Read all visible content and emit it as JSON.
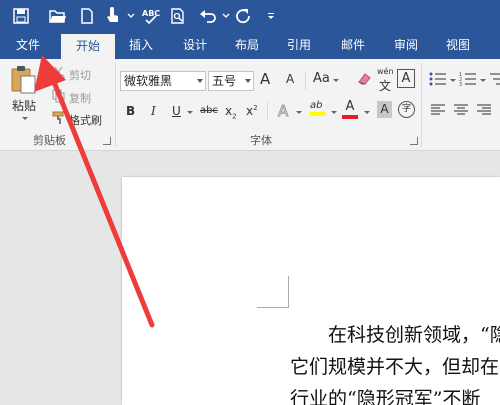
{
  "qat": {
    "icons": [
      "save-icon",
      "open-folder-icon",
      "new-document-icon",
      "touch-mode-icon",
      "spelling-check-icon",
      "print-preview-icon",
      "undo-icon",
      "redo-icon",
      "customize-toolbar-icon"
    ]
  },
  "tabs": [
    {
      "label": "文件",
      "active": false
    },
    {
      "label": "开始",
      "active": true
    },
    {
      "label": "插入",
      "active": false
    },
    {
      "label": "设计",
      "active": false
    },
    {
      "label": "布局",
      "active": false
    },
    {
      "label": "引用",
      "active": false
    },
    {
      "label": "邮件",
      "active": false
    },
    {
      "label": "审阅",
      "active": false
    },
    {
      "label": "视图",
      "active": false
    }
  ],
  "clipboard": {
    "paste_label": "粘贴",
    "cut_label": "剪切",
    "copy_label": "复制",
    "format_painter_label": "格式刷",
    "group_label": "剪贴板"
  },
  "font": {
    "font_name": "微软雅黑",
    "font_size": "五号",
    "grow_font": "A",
    "shrink_font": "A",
    "change_case": "Aa",
    "phonetic_top": "wén",
    "phonetic_bottom": "文",
    "char_border": "A",
    "bold": "B",
    "italic": "I",
    "underline": "U",
    "strikethrough": "abc",
    "subscript": "x",
    "subscript_mark": "2",
    "superscript": "x",
    "superscript_mark": "2",
    "text_effects": "A",
    "highlight": "ab",
    "font_color": "A",
    "char_shading": "A",
    "enclose_char": "字",
    "group_label": "字体"
  },
  "colors": {
    "brand": "#2b579a",
    "highlight": "#ffff00",
    "font_color": "#e51c23",
    "arrow": "#ee3b3b"
  },
  "document": {
    "lines": [
      "在科技创新领域，“隐",
      "它们规模并不大，但却在",
      "行业的“隐形冠军”不断"
    ]
  }
}
